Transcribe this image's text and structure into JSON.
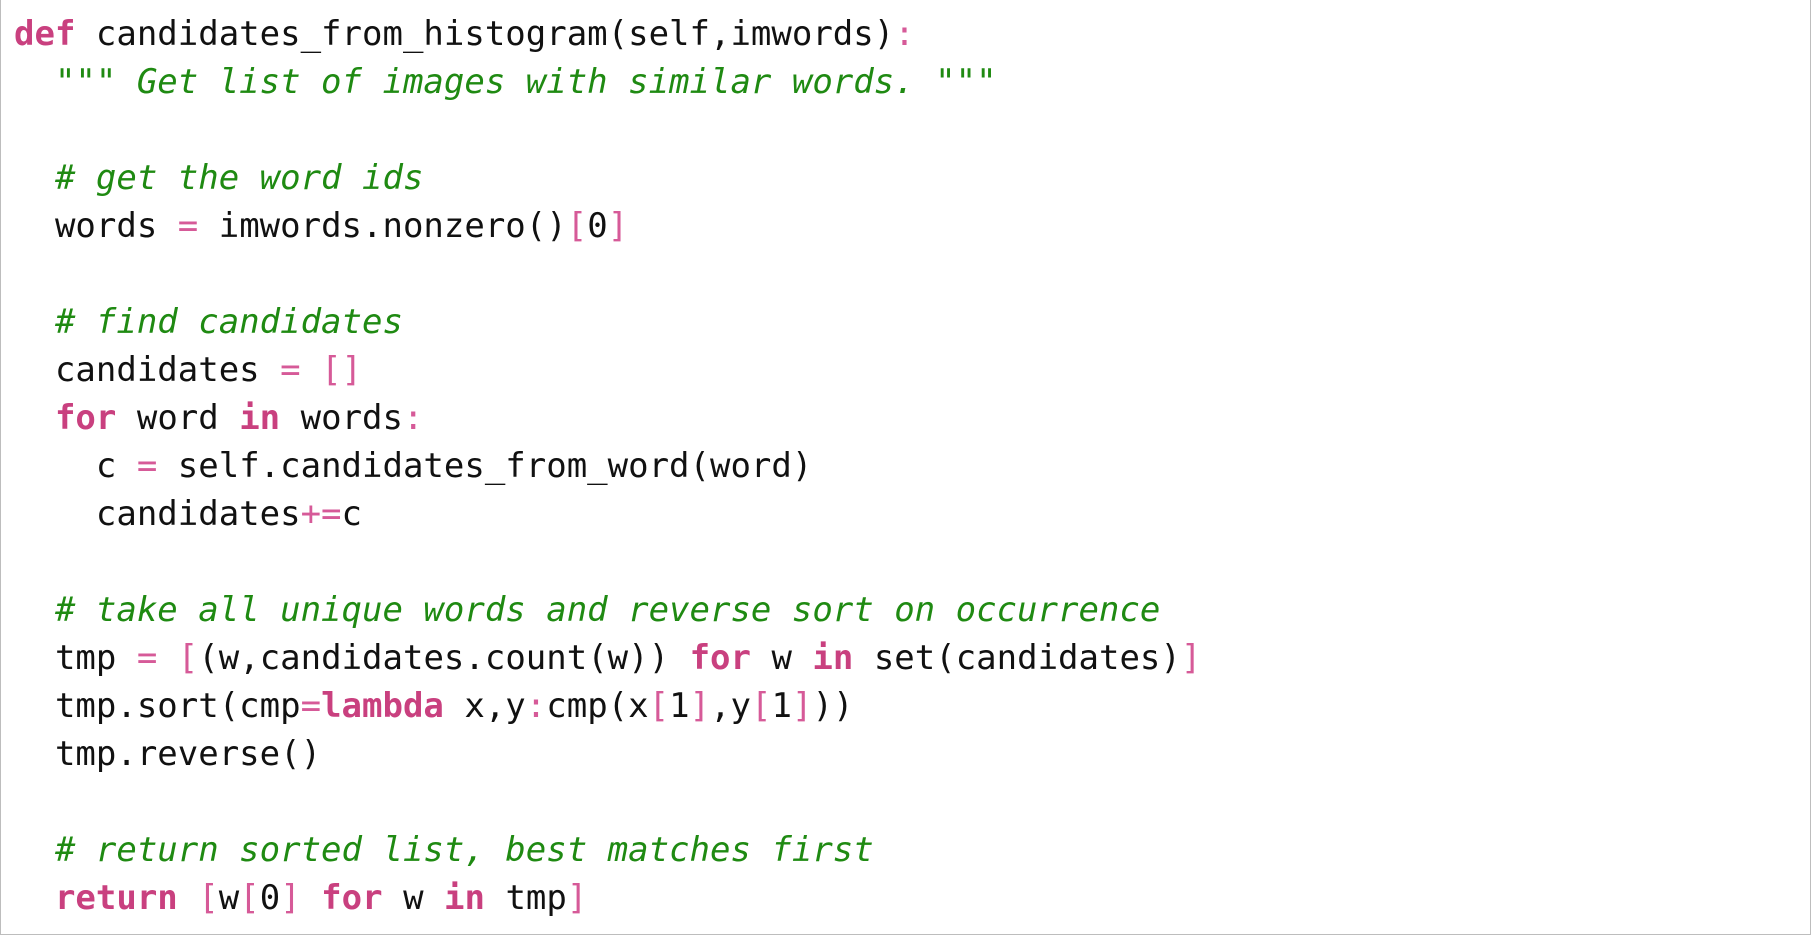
{
  "code": {
    "language": "python",
    "colors": {
      "keyword": "#c9407f",
      "operator": "#d65a98",
      "string": "#1f8a12",
      "comment": "#1f8a12",
      "text": "#111111",
      "border": "#bdbdbd"
    },
    "lines": [
      [
        {
          "type": "kw",
          "text": "def"
        },
        {
          "type": "name",
          "text": " candidates_from_histogram(self,imwords)"
        },
        {
          "type": "op",
          "text": ":"
        }
      ],
      [
        {
          "type": "name",
          "text": "  "
        },
        {
          "type": "str",
          "text": "\"\"\" Get list of images with similar words. \"\"\""
        }
      ],
      [],
      [
        {
          "type": "name",
          "text": "  "
        },
        {
          "type": "cm",
          "text": "# get the word ids"
        }
      ],
      [
        {
          "type": "name",
          "text": "  words "
        },
        {
          "type": "op",
          "text": "="
        },
        {
          "type": "name",
          "text": " imwords.nonzero()"
        },
        {
          "type": "op",
          "text": "["
        },
        {
          "type": "name",
          "text": "0"
        },
        {
          "type": "op",
          "text": "]"
        }
      ],
      [],
      [
        {
          "type": "name",
          "text": "  "
        },
        {
          "type": "cm",
          "text": "# find candidates"
        }
      ],
      [
        {
          "type": "name",
          "text": "  candidates "
        },
        {
          "type": "op",
          "text": "="
        },
        {
          "type": "name",
          "text": " "
        },
        {
          "type": "op",
          "text": "[]"
        }
      ],
      [
        {
          "type": "name",
          "text": "  "
        },
        {
          "type": "kw",
          "text": "for"
        },
        {
          "type": "name",
          "text": " word "
        },
        {
          "type": "kw",
          "text": "in"
        },
        {
          "type": "name",
          "text": " words"
        },
        {
          "type": "op",
          "text": ":"
        }
      ],
      [
        {
          "type": "name",
          "text": "    c "
        },
        {
          "type": "op",
          "text": "="
        },
        {
          "type": "name",
          "text": " self.candidates_from_word(word)"
        }
      ],
      [
        {
          "type": "name",
          "text": "    candidates"
        },
        {
          "type": "op",
          "text": "+="
        },
        {
          "type": "name",
          "text": "c"
        }
      ],
      [],
      [
        {
          "type": "name",
          "text": "  "
        },
        {
          "type": "cm",
          "text": "# take all unique words and reverse sort on occurrence"
        }
      ],
      [
        {
          "type": "name",
          "text": "  tmp "
        },
        {
          "type": "op",
          "text": "="
        },
        {
          "type": "name",
          "text": " "
        },
        {
          "type": "op",
          "text": "["
        },
        {
          "type": "name",
          "text": "(w,candidates.count(w)) "
        },
        {
          "type": "kw",
          "text": "for"
        },
        {
          "type": "name",
          "text": " w "
        },
        {
          "type": "kw",
          "text": "in"
        },
        {
          "type": "name",
          "text": " set(candidates)"
        },
        {
          "type": "op",
          "text": "]"
        }
      ],
      [
        {
          "type": "name",
          "text": "  tmp.sort(cmp"
        },
        {
          "type": "op",
          "text": "="
        },
        {
          "type": "kw",
          "text": "lambda"
        },
        {
          "type": "name",
          "text": " x,y"
        },
        {
          "type": "op",
          "text": ":"
        },
        {
          "type": "name",
          "text": "cmp(x"
        },
        {
          "type": "op",
          "text": "["
        },
        {
          "type": "name",
          "text": "1"
        },
        {
          "type": "op",
          "text": "]"
        },
        {
          "type": "name",
          "text": ",y"
        },
        {
          "type": "op",
          "text": "["
        },
        {
          "type": "name",
          "text": "1"
        },
        {
          "type": "op",
          "text": "]"
        },
        {
          "type": "name",
          "text": "))"
        }
      ],
      [
        {
          "type": "name",
          "text": "  tmp.reverse()"
        }
      ],
      [],
      [
        {
          "type": "name",
          "text": "  "
        },
        {
          "type": "cm",
          "text": "# return sorted list, best matches first"
        }
      ],
      [
        {
          "type": "name",
          "text": "  "
        },
        {
          "type": "kw",
          "text": "return"
        },
        {
          "type": "name",
          "text": " "
        },
        {
          "type": "op",
          "text": "["
        },
        {
          "type": "name",
          "text": "w"
        },
        {
          "type": "op",
          "text": "["
        },
        {
          "type": "name",
          "text": "0"
        },
        {
          "type": "op",
          "text": "]"
        },
        {
          "type": "name",
          "text": " "
        },
        {
          "type": "kw",
          "text": "for"
        },
        {
          "type": "name",
          "text": " w "
        },
        {
          "type": "kw",
          "text": "in"
        },
        {
          "type": "name",
          "text": " tmp"
        },
        {
          "type": "op",
          "text": "]"
        }
      ]
    ]
  }
}
